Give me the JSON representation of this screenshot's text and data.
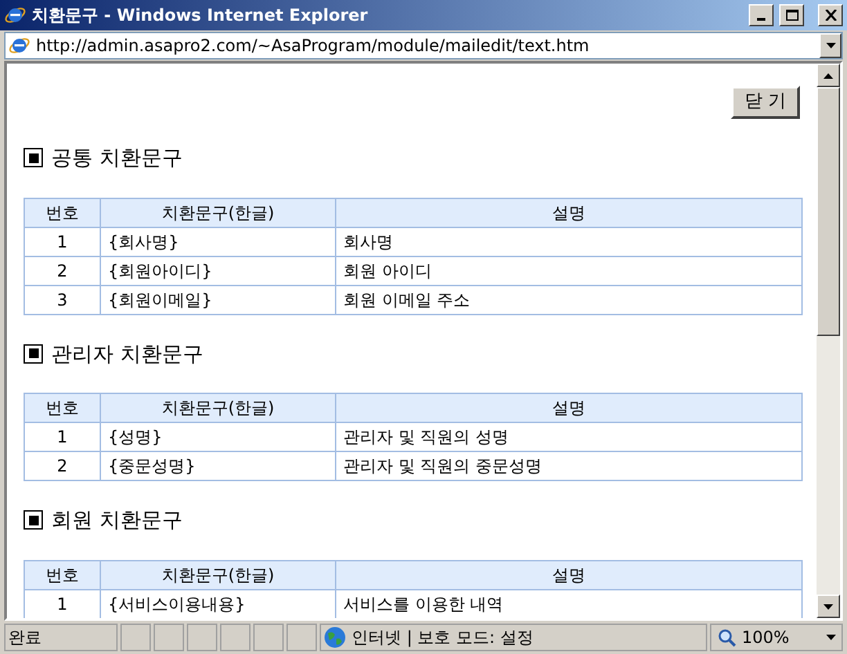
{
  "window": {
    "title": "치환문구 - Windows Internet Explorer"
  },
  "address_bar": {
    "url": "http://admin.asapro2.com/~AsaProgram/module/mailedit/text.htm"
  },
  "close_button": "닫 기",
  "sections": [
    {
      "heading": "공통 치환문구",
      "columns": [
        "번호",
        "치환문구(한글)",
        "설명"
      ],
      "rows": [
        {
          "no": "1",
          "code": "{회사명}",
          "desc": "회사명"
        },
        {
          "no": "2",
          "code": "{회원아이디}",
          "desc": "회원 아이디"
        },
        {
          "no": "3",
          "code": "{회원이메일}",
          "desc": "회원 이메일 주소"
        }
      ]
    },
    {
      "heading": "관리자 치환문구",
      "columns": [
        "번호",
        "치환문구(한글)",
        "설명"
      ],
      "rows": [
        {
          "no": "1",
          "code": "{성명}",
          "desc": "관리자 및 직원의 성명"
        },
        {
          "no": "2",
          "code": "{중문성명}",
          "desc": "관리자 및 직원의 중문성명"
        }
      ]
    },
    {
      "heading": "회원 치환문구",
      "columns": [
        "번호",
        "치환문구(한글)",
        "설명"
      ],
      "rows": [
        {
          "no": "1",
          "code": "{서비스이용내용}",
          "desc": "서비스를 이용한 내역"
        }
      ]
    }
  ],
  "status_bar": {
    "status": "완료",
    "zone": "인터넷 | 보호 모드: 설정",
    "zoom": "100%"
  }
}
